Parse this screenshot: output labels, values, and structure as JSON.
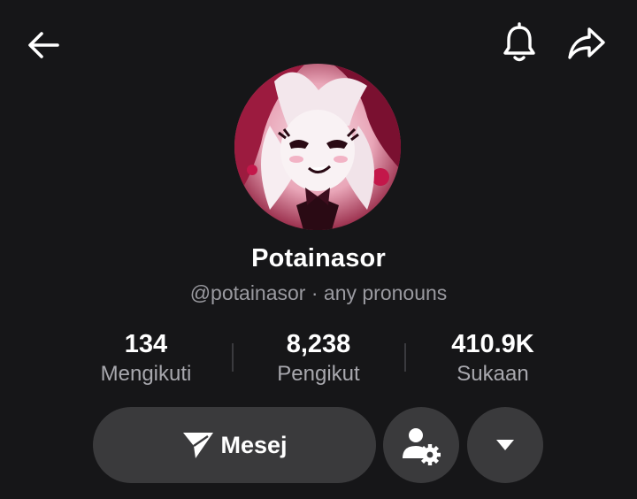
{
  "header": {
    "back_icon": "arrow-left-icon",
    "bell_icon": "bell-icon",
    "share_icon": "share-arrow-icon"
  },
  "profile": {
    "display_name": "Potainasor",
    "handle_line": "@potainasor · any pronouns",
    "avatar": "profile-avatar"
  },
  "stats": [
    {
      "value": "134",
      "label": "Mengikuti"
    },
    {
      "value": "8,238",
      "label": "Pengikut"
    },
    {
      "value": "410.9K",
      "label": "Sukaan"
    }
  ],
  "actions": {
    "message_label": "Mesej",
    "message_icon": "send-icon",
    "user_settings_icon": "user-gear-icon",
    "more_icon": "caret-down-icon"
  },
  "colors": {
    "background": "#161618",
    "button": "#3a3a3c",
    "muted_text": "#9a9aa0",
    "accent_pink": "#d4245a"
  }
}
